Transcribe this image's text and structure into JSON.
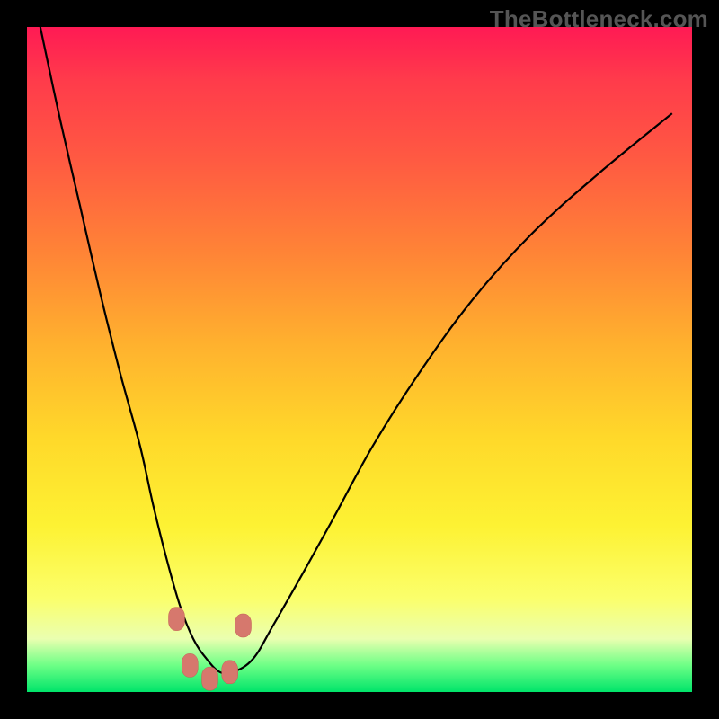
{
  "watermark": "TheBottleneck.com",
  "chart_data": {
    "type": "line",
    "title": "",
    "xlabel": "",
    "ylabel": "",
    "xlim": [
      0,
      100
    ],
    "ylim": [
      0,
      100
    ],
    "annotations": [],
    "series": [
      {
        "name": "curve",
        "x": [
          2,
          5,
          8,
          11,
          14,
          17,
          19,
          21,
          23,
          25,
          27,
          29,
          31,
          34,
          37,
          41,
          46,
          52,
          59,
          67,
          76,
          86,
          97
        ],
        "values": [
          100,
          86,
          73,
          60,
          48,
          37,
          28,
          20,
          13,
          8,
          5,
          3,
          3,
          5,
          10,
          17,
          26,
          37,
          48,
          59,
          69,
          78,
          87
        ]
      }
    ],
    "markers": [
      {
        "x": 22.5,
        "y": 11
      },
      {
        "x": 24.5,
        "y": 4
      },
      {
        "x": 27.5,
        "y": 2
      },
      {
        "x": 30.5,
        "y": 3
      },
      {
        "x": 32.5,
        "y": 10
      }
    ],
    "gradient_note": "background encodes bottleneck severity: red=high, green=low"
  }
}
